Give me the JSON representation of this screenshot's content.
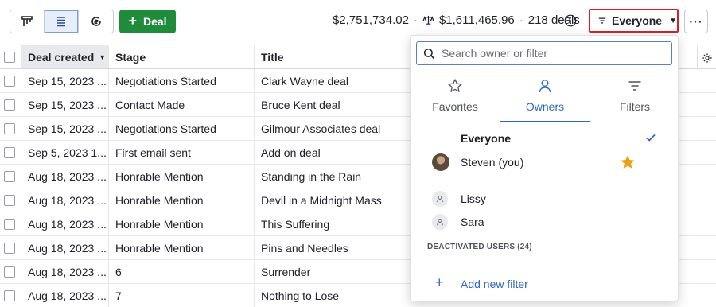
{
  "toolbar": {
    "views": [
      {
        "icon": "pipeline-view-icon",
        "active": false
      },
      {
        "icon": "list-view-icon",
        "active": true
      },
      {
        "icon": "forecast-view-icon",
        "active": false
      }
    ],
    "add_deal_label": "Deal",
    "total_value": "$2,751,734.02",
    "weighted_value": "$1,611,465.96",
    "deal_count": "218 deals",
    "owner_filter_label": "Everyone",
    "more_label": "···"
  },
  "table": {
    "headers": {
      "date": "Deal created",
      "stage": "Stage",
      "title": "Title"
    },
    "rows": [
      {
        "date": "Sep 15, 2023 ...",
        "stage": "Negotiations Started",
        "title": "Clark Wayne deal"
      },
      {
        "date": "Sep 15, 2023 ...",
        "stage": "Contact Made",
        "title": "Bruce Kent deal"
      },
      {
        "date": "Sep 15, 2023 ...",
        "stage": "Negotiations Started",
        "title": "Gilmour Associates deal"
      },
      {
        "date": "Sep 5, 2023 1...",
        "stage": "First email sent",
        "title": "Add on deal"
      },
      {
        "date": "Aug 18, 2023 ...",
        "stage": "Honrable Mention",
        "title": "Standing in the Rain"
      },
      {
        "date": "Aug 18, 2023 ...",
        "stage": "Honrable Mention",
        "title": "Devil in a Midnight Mass"
      },
      {
        "date": "Aug 18, 2023 ...",
        "stage": "Honrable Mention",
        "title": "This Suffering"
      },
      {
        "date": "Aug 18, 2023 ...",
        "stage": "Honrable Mention",
        "title": "Pins and Needles"
      },
      {
        "date": "Aug 18, 2023 ...",
        "stage": "6",
        "title": "Surrender"
      },
      {
        "date": "Aug 18, 2023 ...",
        "stage": "7",
        "title": "Nothing to Lose"
      }
    ],
    "peek_text": "s"
  },
  "dropdown": {
    "search_placeholder": "Search owner or filter",
    "tabs": [
      {
        "label": "Favorites",
        "icon": "star-outline-icon",
        "active": false
      },
      {
        "label": "Owners",
        "icon": "person-icon",
        "active": true
      },
      {
        "label": "Filters",
        "icon": "filter-lines-icon",
        "active": false
      }
    ],
    "everyone_label": "Everyone",
    "current_user_label": "Steven (you)",
    "users": [
      "Lissy",
      "Sara"
    ],
    "deactivated_label": "DEACTIVATED USERS (24)",
    "add_filter_label": "Add new filter"
  },
  "colors": {
    "brand_green": "#208b3a",
    "accent_blue": "#2f66c9",
    "highlight_red": "#d6212b",
    "star_gold": "#e8a317"
  }
}
